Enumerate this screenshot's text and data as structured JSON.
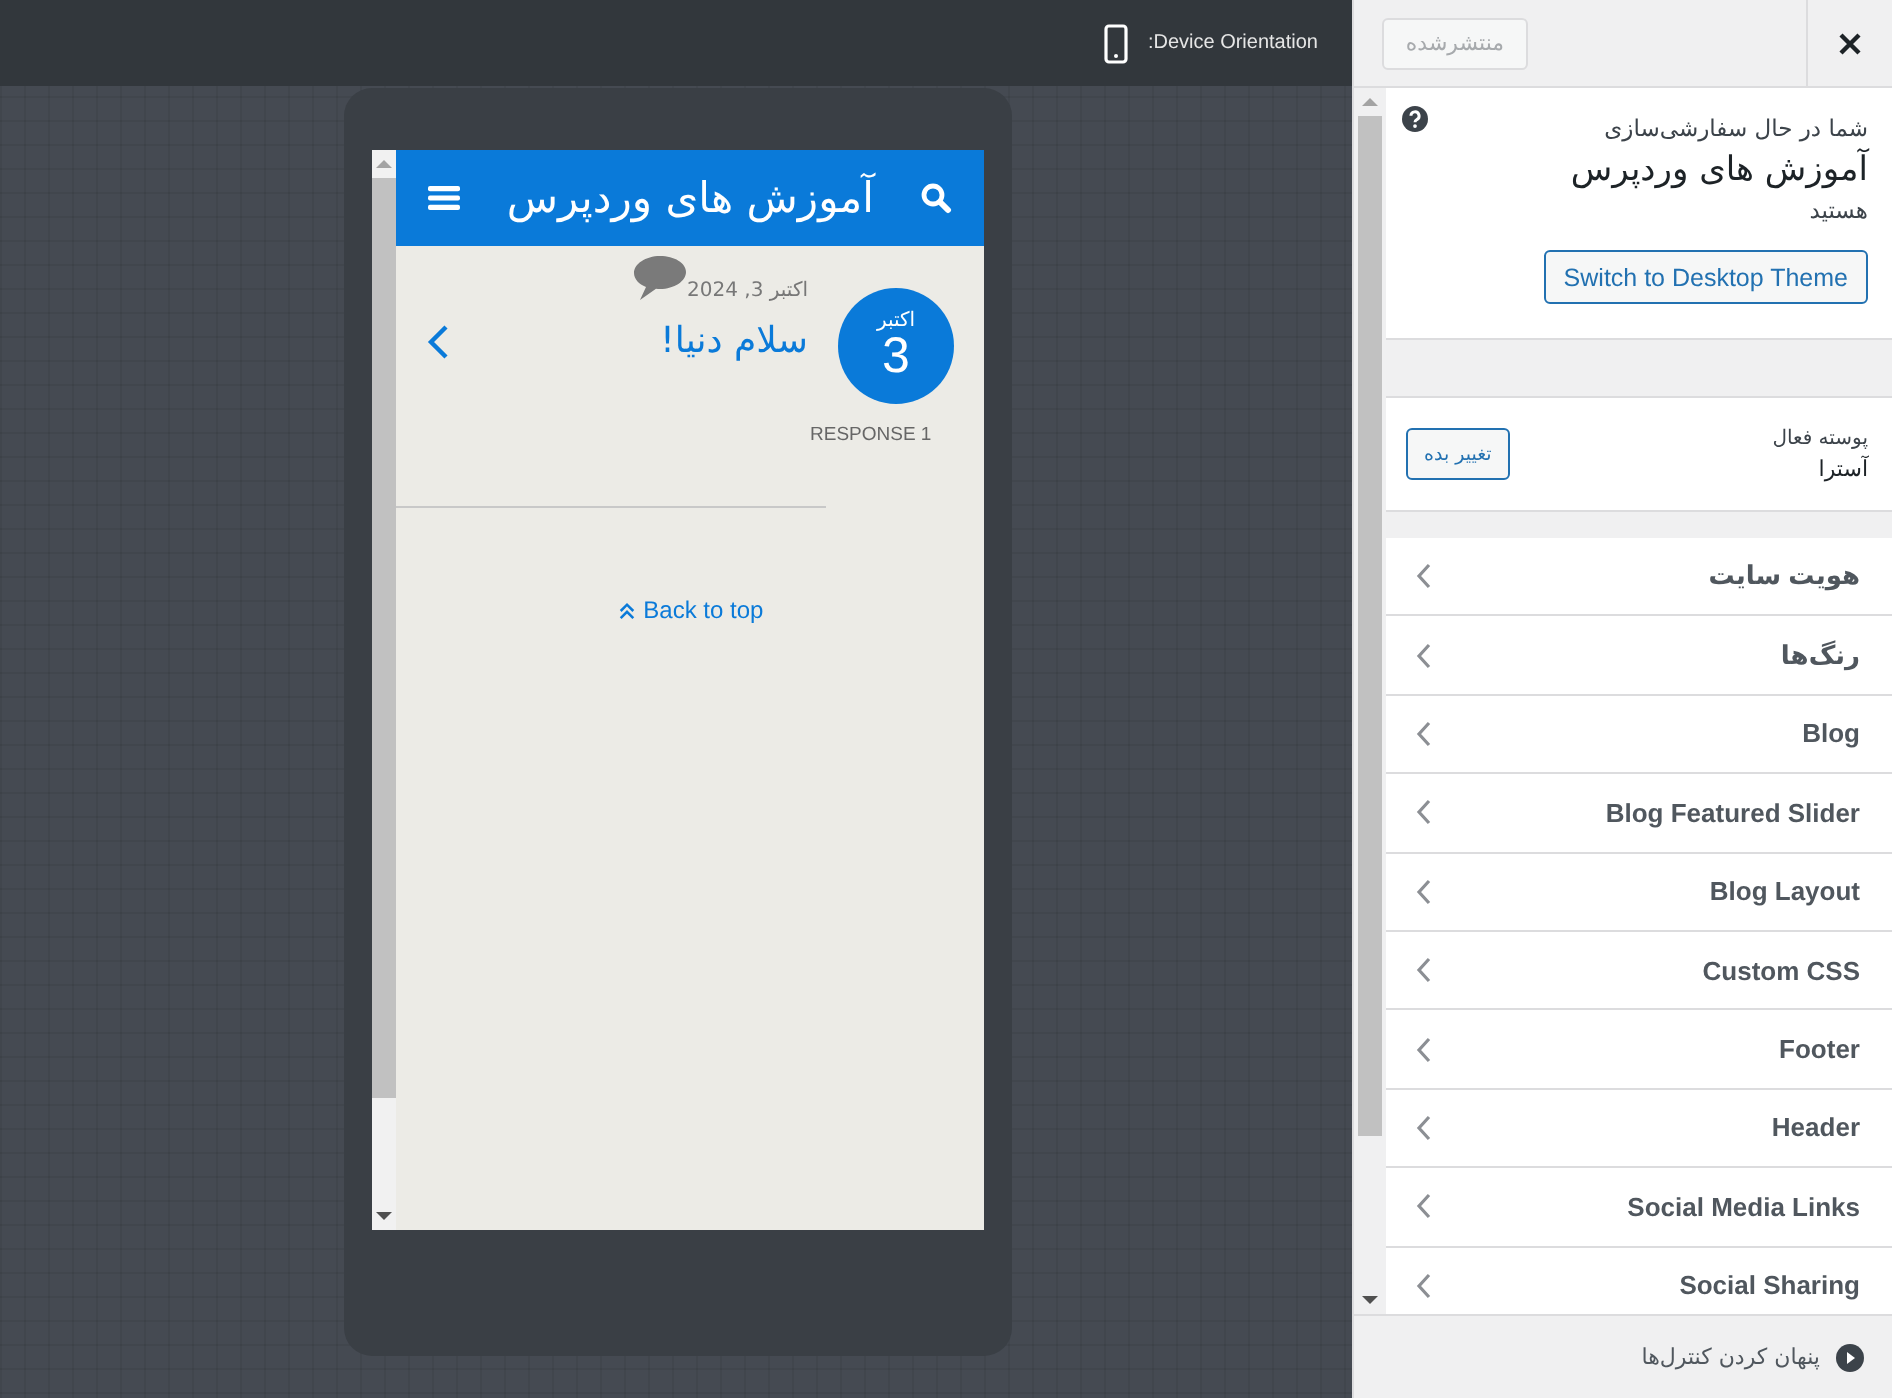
{
  "toolbar": {
    "orientation_label": ":Device Orientation"
  },
  "preview": {
    "site_title": "آموزش های وردپرس",
    "post": {
      "month": "اکتبر",
      "day": "3",
      "date": "اکتبر 3, 2024",
      "title": "سلام دنیا!",
      "responses": "RESPONSE 1"
    },
    "back_to_top": "Back to top"
  },
  "panel": {
    "publish_button": {
      "label": "منتشرشده",
      "disabled": true
    },
    "info": {
      "line_1": "شما در حال سفارشی‌سازی",
      "site_name": "آموزش های وردپرس",
      "line_2": "هستید",
      "button": "Switch to Desktop Theme"
    },
    "theme": {
      "label": "پوسته فعال",
      "name": "آسترا",
      "button": "تغییر بده"
    },
    "sections": [
      {
        "label": "هویت سایت"
      },
      {
        "label": "رنگ‌ها"
      },
      {
        "label": "Blog"
      },
      {
        "label": "Blog Featured Slider"
      },
      {
        "label": "Blog Layout"
      },
      {
        "label": "Custom CSS"
      },
      {
        "label": "Footer"
      },
      {
        "label": "Header"
      },
      {
        "label": "Social Media Links"
      },
      {
        "label": "Social Sharing"
      }
    ],
    "hide_controls": "پنهان کردن کنترل‌ها"
  }
}
